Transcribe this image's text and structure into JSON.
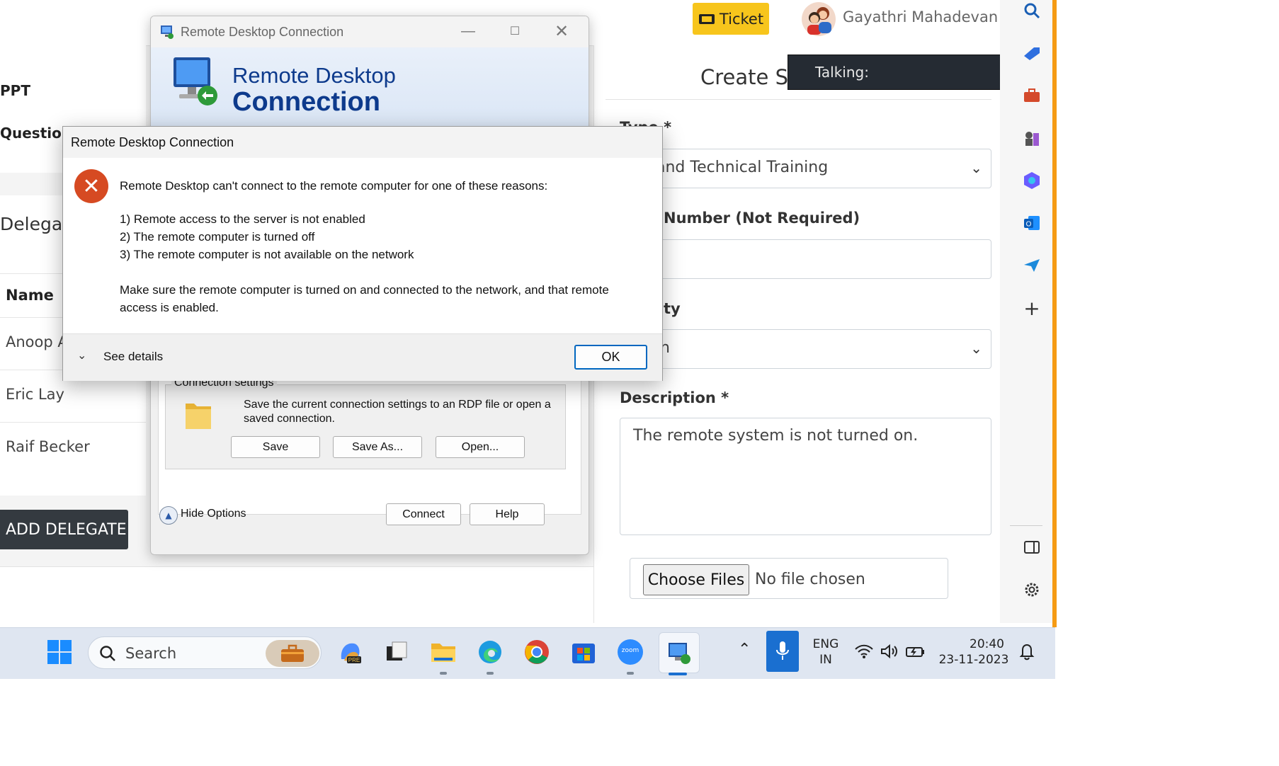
{
  "browser_page": {
    "ticket_button": "Ticket",
    "user_name": "Gayathri Mahadevan",
    "left_items": [
      "PPT",
      "Questions"
    ],
    "delegate_heading": "Delegate",
    "delegate_table_header": "Name",
    "delegates": [
      "Anoop Ar",
      "Eric Lay",
      "Raif Becker"
    ],
    "add_delegate_button": "ADD DELEGATE",
    "form_title": "Create Su",
    "type_label": "Type *",
    "type_value": "and Technical Training",
    "number_label": "Number (Not Required)",
    "priority_label": "ty",
    "priority_value": "h",
    "description_label": "Description *",
    "description_value": "The remote system is not turned on.",
    "file_button": "Choose Files",
    "file_status": "No file chosen",
    "talking_label": "Talking:"
  },
  "rdc_window": {
    "title": "Remote Desktop Connection",
    "banner_line1": "Remote Desktop",
    "banner_line2": "Connection",
    "group_label": "Connection settings",
    "group_text": "Save the current connection settings to an RDP file or open a saved connection.",
    "save_button": "Save",
    "save_as_button": "Save As...",
    "open_button": "Open...",
    "hide_options": "Hide Options",
    "connect_button": "Connect",
    "help_button": "Help"
  },
  "error_dialog": {
    "title": "Remote Desktop Connection",
    "message": "Remote Desktop can't connect to the remote computer for one of these reasons:",
    "reasons": [
      "1) Remote access to the server is not enabled",
      "2) The remote computer is turned off",
      "3) The remote computer is not available on the network"
    ],
    "advice_line1": "Make sure the remote computer is turned on and connected to the network, and that remote",
    "advice_line2": "access is enabled.",
    "see_details": "See details",
    "ok_button": "OK"
  },
  "taskbar": {
    "search_placeholder": "Search",
    "language_line1": "ENG",
    "language_line2": "IN",
    "time": "20:40",
    "date": "23-11-2023",
    "zoom_label": "zoom"
  },
  "colors": {
    "ticket_yellow": "#f7c51c",
    "error_red": "#d64a22",
    "accent_blue": "#0067c0",
    "edge_orange": "#f59b14"
  }
}
